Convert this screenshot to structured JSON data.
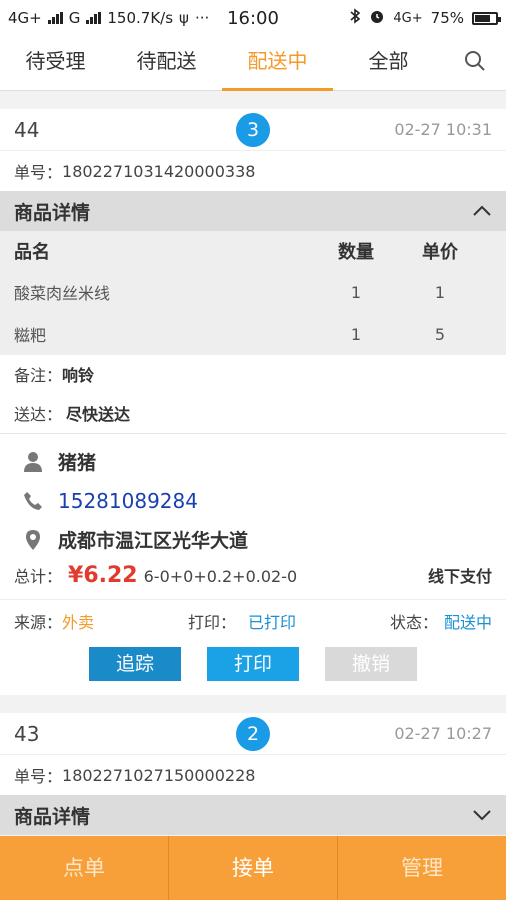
{
  "status_bar": {
    "net1": "4G+",
    "net2": "G",
    "speed": "150.7K/s",
    "dots": "···",
    "time": "16:00",
    "net3": "4G+",
    "battery": "75%"
  },
  "tabs": [
    {
      "label": "待受理",
      "active": false
    },
    {
      "label": "待配送",
      "active": false
    },
    {
      "label": "配送中",
      "active": true
    },
    {
      "label": "全部",
      "active": false
    }
  ],
  "orders": [
    {
      "number": "44",
      "badge": "3",
      "time": "02-27 10:31",
      "order_no_label": "单号：",
      "order_no": "1802271031420000338",
      "details_title": "商品详情",
      "goods_header": {
        "name": "品名",
        "qty": "数量",
        "price": "单价"
      },
      "goods": [
        {
          "name": "酸菜肉丝米线",
          "qty": "1",
          "price": "1"
        },
        {
          "name": "糍粑",
          "qty": "1",
          "price": "5"
        }
      ],
      "note_label": "备注：",
      "note": "响铃",
      "deliver_label": "送达：",
      "deliver": "尽快送达",
      "customer": "猪猪",
      "phone": "15281089284",
      "address": "成都市温江区光华大道",
      "total_label": "总计：",
      "total": "¥6.22",
      "total_breakdown": "6-0+0+0.2+0.02-0",
      "payment": "线下支付",
      "source_label": "来源：",
      "source": "外卖",
      "print_label": "打印：",
      "print_status": "已打印",
      "state_label": "状态：",
      "state": "配送中",
      "actions": {
        "track": "追踪",
        "print": "打印",
        "cancel": "撤销"
      }
    },
    {
      "number": "43",
      "badge": "2",
      "time": "02-27 10:27",
      "order_no_label": "单号：",
      "order_no": "1802271027150000228",
      "details_title": "商品详情"
    }
  ],
  "footer": [
    {
      "label": "点单",
      "active": false
    },
    {
      "label": "接单",
      "active": true
    },
    {
      "label": "管理",
      "active": false
    }
  ],
  "colors": {
    "accent": "#f39a2b",
    "badge": "#1a9be6",
    "price": "#e03b2e",
    "phone": "#1a3fb0"
  }
}
